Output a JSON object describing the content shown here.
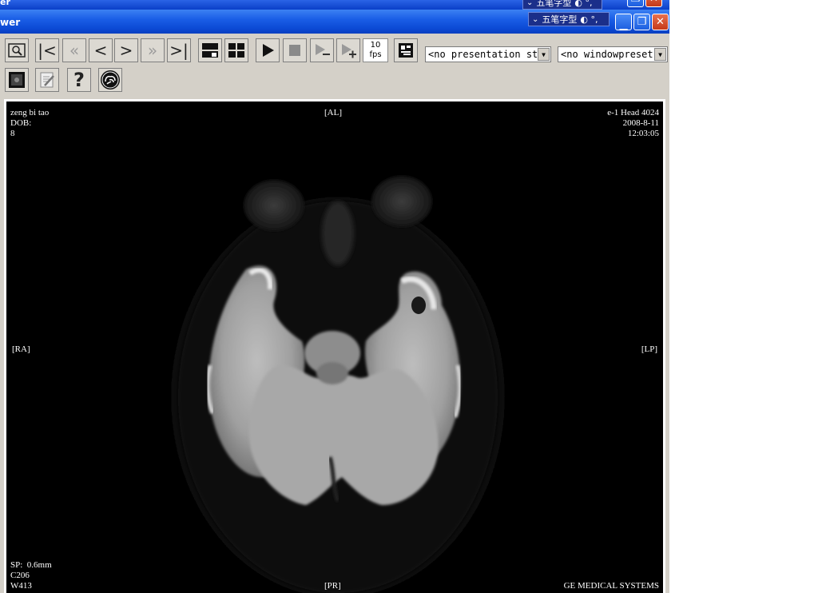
{
  "window": {
    "back_title": "er",
    "title": "wer"
  },
  "ime": {
    "label": "五笔字型",
    "symbols": "◐ °,"
  },
  "toolbar": {
    "fps_value": "10",
    "fps_unit": "fps",
    "presentation_combo": "<no presentation st",
    "windowpreset_combo": "<no windowpreset",
    "help_label": "?"
  },
  "overlay": {
    "patient_name": "zeng bi tao",
    "dob": "DOB:",
    "age": "8",
    "top_label": "[AL]",
    "series": "e-1 Head 4024",
    "date": "2008-8-11",
    "time": "12:03:05",
    "left_label": "[RA]",
    "right_label": "[LP]",
    "bottom_label": "[PR]",
    "sp": "SP:  0.6mm",
    "center": "C206",
    "width": "W413",
    "manufacturer": "GE MEDICAL SYSTEMS"
  },
  "colors": {
    "titlebar": "#0b49d4",
    "toolbar_bg": "#d4d0c8",
    "viewer_bg": "#000000",
    "close_button": "#c5391a"
  }
}
